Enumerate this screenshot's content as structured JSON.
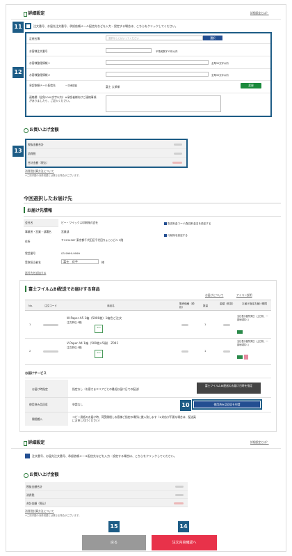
{
  "detail": {
    "title": "詳細設定",
    "help": "詳細設定とは？",
    "toggle_text": "注文番号、お届先注文番号、承認依頼メール配信先などを入力・設定する場合は、こちらをクリックしてください。"
  },
  "form": {
    "file_name_label": "定規名簿",
    "file_placeholder": "選択なしにはいってください",
    "select_btn": "選択",
    "order_no_label": "お客様注文番号",
    "order_no_hint": "半角英数字12桁以内",
    "memo1_label": "お客様整理情報１",
    "memo1_hint": "全角30文字以内",
    "memo2_label": "お客様整理情報２",
    "memo2_hint": "全角30文字以内",
    "approver_label": "承認依頼メール配信先",
    "approver_sub": "一次承認者",
    "approver_name": "富士 太郎様",
    "change_btn": "変更",
    "remarks_label": "連絡欄（全角1000文字以内）※承認者様向けご連絡事項がありましたら、ご記入ください。"
  },
  "purchase": {
    "title": "お買い上げ金額",
    "rows": [
      "税抜金額合計",
      "消費税",
      "合計金額（税込）"
    ],
    "note_link": "消費税計算方法について",
    "note": "※ご請求額の消費税額とは異なる場合がございます。"
  },
  "delivery": {
    "title": "今回選択したお届け先",
    "sub": "お届け先情報",
    "rows": [
      {
        "label": "会社名",
        "value": "ピー・ワイックス印刷株式会社"
      },
      {
        "label": "事業所・営業・部署名",
        "value": "営業部"
      },
      {
        "label": "住所",
        "value": "〒1234567 東京都千代田区千代田ちょ○○ビル 3階"
      },
      {
        "label": "電話番号",
        "value": "03-9999-9999"
      },
      {
        "label": "受取担当者名",
        "value": "富士　花子",
        "suffix": "様"
      }
    ],
    "side_links": [
      "配送料金コード/配送料金名を設定する",
      "行削除を設定する"
    ],
    "link_bottom": "送付先を追加する"
  },
  "products": {
    "title": "富士フイルムBI配送でお届けする商品",
    "top_links": [
      "お届けについて",
      "アイコン説明"
    ],
    "headers": [
      "No.",
      "注文コード",
      "商品名",
      "販売価格（税抜）",
      "数量",
      "金額（税抜）",
      "お届け指定お届け期限"
    ],
    "items": [
      {
        "no": "1",
        "name": "W-Paper A5 1箱（5000枚）1箱色ご注文",
        "sub": "注文単位:5箱",
        "qty": "1",
        "delivery": "当社表示箇所発日（土日祝、一部地域除く）"
      },
      {
        "no": "2",
        "name": "V-Paper A4 1箱（500枚×5冊） Z091",
        "sub": "注文単位:5箱",
        "qty": "1",
        "delivery": "当社表示箇所発日（土日祝、一部地域除く）"
      }
    ],
    "eco": "eco"
  },
  "services": {
    "title": "お届けサービス",
    "rows": [
      {
        "label": "お届け時指定",
        "value": "指定なし（お客さまエリアごとの最短お届け日での配送）",
        "btn": "富士フイルムBI配送のお届け日時を指定"
      },
      {
        "label": "使用済み品回収",
        "value": "申請なし",
        "btn": "使用済み品回収を申請"
      },
      {
        "label": "開梱搬入",
        "value": "コピー用紙のお届け時、荷受開梱しお客様ご指定の場所に搬入致します（※対応が不要な場合は、配送員にお申し付けください）"
      }
    ]
  },
  "detail2": {
    "title": "詳細設定",
    "help": "詳細設定とは？",
    "toggle_text": "注文番号、お届先注文番号、承認依頼メール配信先などを入力・設定する場合は、こちらをクリックしてください。"
  },
  "purchase2": {
    "title": "お買い上げ金額",
    "rows": [
      "税抜金額合計",
      "消費税",
      "合計金額（税込）"
    ],
    "note_link": "消費税計算方法について",
    "note": "※ご請求額の消費税額とは異なる場合がございます。"
  },
  "buttons": {
    "back": "戻る",
    "confirm": "注文内容確認へ"
  },
  "callouts": {
    "c11": "11",
    "c12": "12",
    "c13": "13",
    "c10": "10",
    "c15": "15",
    "c14": "14"
  },
  "colors": {
    "callout": "#1d5c86",
    "green": "#1b8a3c",
    "red": "#e8324a",
    "gray": "#999999"
  }
}
